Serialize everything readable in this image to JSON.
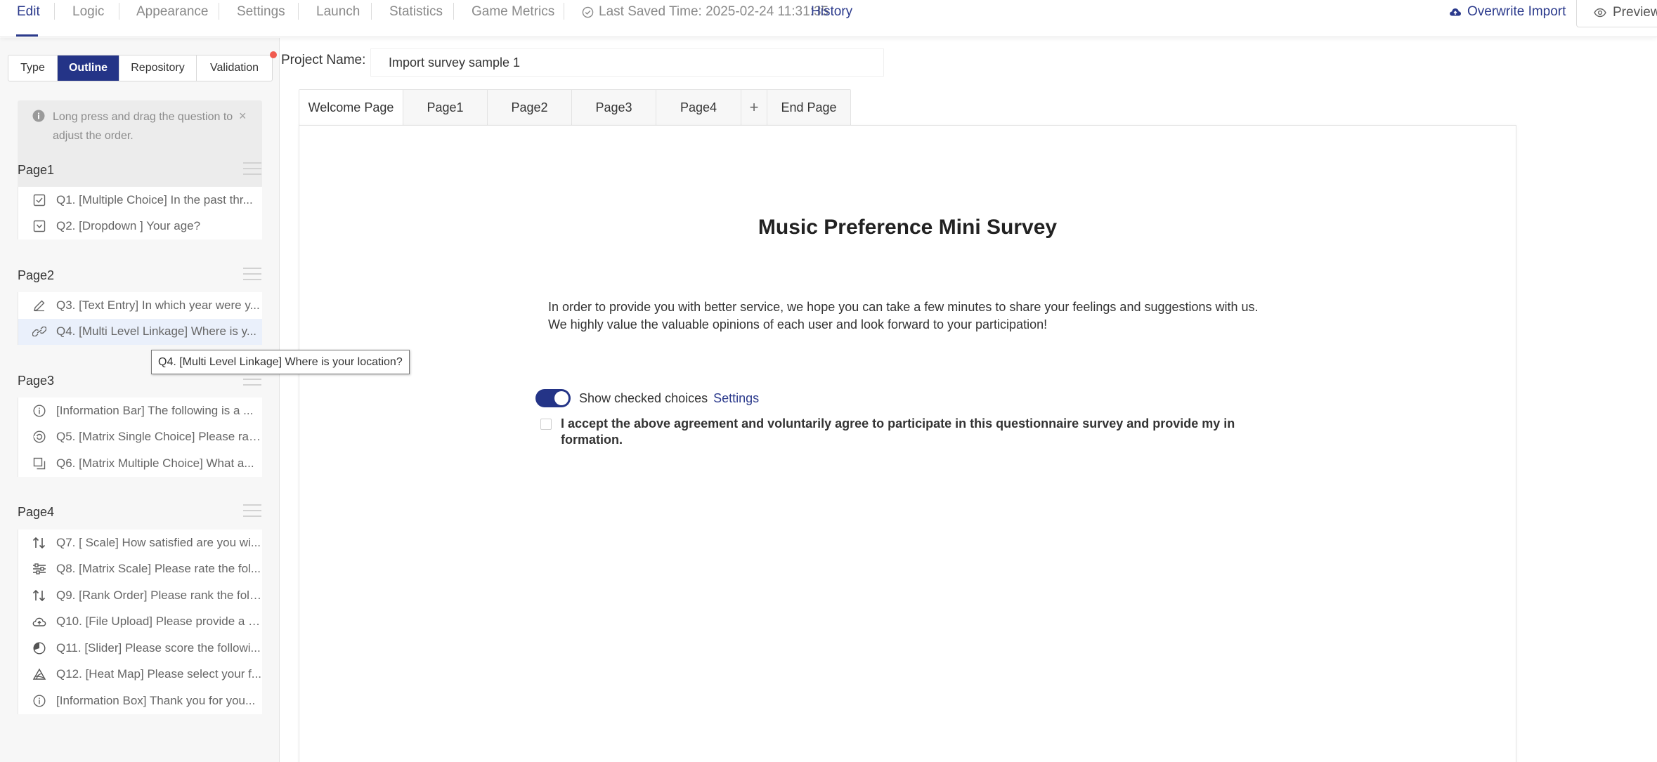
{
  "nav": {
    "tabs": [
      "Edit",
      "Logic",
      "Appearance",
      "Settings",
      "Launch",
      "Statistics",
      "Game Metrics"
    ],
    "active": "Edit",
    "saved_label": "Last Saved Time: 2025-02-24 11:31:35",
    "history_label": "History",
    "overwrite_label": "Overwrite Import",
    "preview_label": "Preview"
  },
  "sidebar": {
    "segments": [
      "Type",
      "Outline",
      "Repository",
      "Validation"
    ],
    "active_segment": "Outline",
    "tip_text": "Long press and drag the question to adjust the order.",
    "tip_close": "×",
    "pages": [
      {
        "title": "Page1",
        "items": [
          {
            "icon": "checkbox-icon",
            "text": "Q1. [Multiple Choice] In the past thr..."
          },
          {
            "icon": "dropdown-icon",
            "text": "Q2. [Dropdown ] Your age?"
          }
        ]
      },
      {
        "title": "Page2",
        "items": [
          {
            "icon": "pencil-icon",
            "text": "Q3. [Text Entry] In which year were y..."
          },
          {
            "icon": "link-icon",
            "text": "Q4. [Multi Level Linkage] Where is y...",
            "selected": true
          }
        ]
      },
      {
        "title": "Page3",
        "items": [
          {
            "icon": "info-icon",
            "text": "[Information Bar] The following is a ..."
          },
          {
            "icon": "matrix-single-icon",
            "text": "Q5. [Matrix Single Choice] Please rat..."
          },
          {
            "icon": "matrix-multiple-icon",
            "text": "Q6. [Matrix Multiple Choice] What a..."
          }
        ]
      },
      {
        "title": "Page4",
        "items": [
          {
            "icon": "scale-arrows-icon",
            "text": "Q7. [ Scale] How satisfied are you wi..."
          },
          {
            "icon": "sliders-icon",
            "text": "Q8. [Matrix Scale] Please rate the fol..."
          },
          {
            "icon": "rank-arrows-icon",
            "text": "Q9. [Rank Order] Please rank the foll..."
          },
          {
            "icon": "cloud-upload-icon",
            "text": "Q10. [File Upload] Please provide a s..."
          },
          {
            "icon": "pie-icon",
            "text": "Q11. [Slider] Please score the followi..."
          },
          {
            "icon": "heatmap-icon",
            "text": "Q12. [Heat Map] Please select your f..."
          },
          {
            "icon": "info-icon",
            "text": "[Information Box] Thank you for you..."
          }
        ]
      }
    ],
    "tooltip": "Q4. [Multi Level Linkage] Where is your location?"
  },
  "project": {
    "label": "Project Name:",
    "value": "Import survey sample 1"
  },
  "page_tabs": [
    "Welcome Page",
    "Page1",
    "Page2",
    "Page3",
    "Page4",
    "+",
    "End Page"
  ],
  "active_page_tab": "Welcome Page",
  "survey": {
    "title": "Music Preference Mini Survey",
    "desc_line1": "In order to provide you with better service, we hope you can take a few minutes to share your feelings and suggestions with us.",
    "desc_line2": "We highly value the valuable opinions of each user and look forward to your participation!",
    "toggle_label": "Show checked choices",
    "toggle_on": true,
    "settings_label": "Settings",
    "agreement": "I accept the above agreement and voluntarily agree to participate in this questionnaire survey and provide my information."
  },
  "colors": {
    "accent": "#243487",
    "link": "#2b3a8c",
    "red_dot": "#f05a4f"
  }
}
